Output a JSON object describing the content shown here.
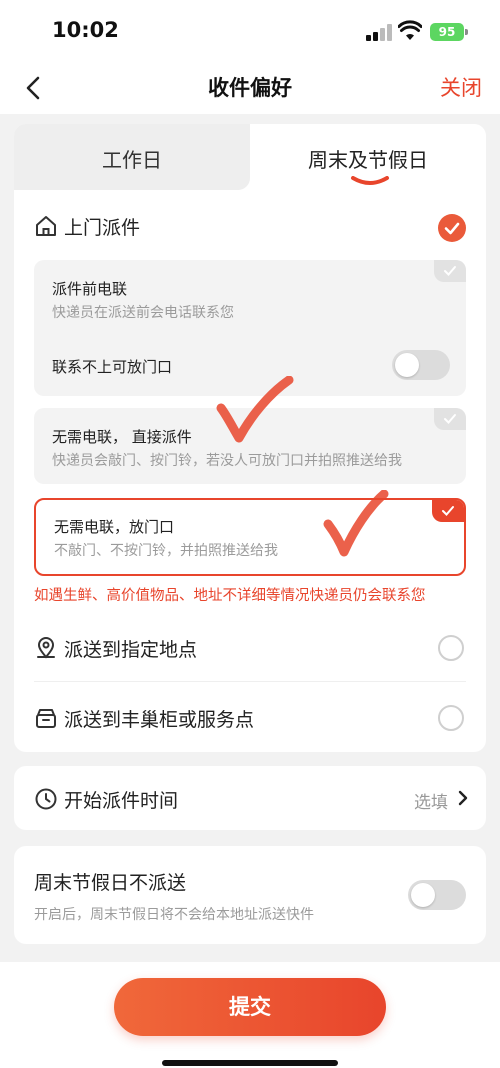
{
  "status_bar": {
    "time": "10:02",
    "battery": "95"
  },
  "nav": {
    "title": "收件偏好",
    "close_label": "关闭"
  },
  "tabs": [
    {
      "label": "工作日",
      "selected": false
    },
    {
      "label": "周末及节假日",
      "selected": true
    }
  ],
  "door_delivery": {
    "label": "上门派件",
    "checked": true,
    "options": [
      {
        "title": "派件前电联",
        "desc": "快递员在派送前会电话联系您",
        "selected": false
      },
      {
        "title": "无需电联， 直接派件",
        "desc": "快递员会敲门、按门铃，若没人可放门口并拍照推送给我",
        "selected": false
      },
      {
        "title": "无需电联，放门口",
        "desc": "不敲门、不按门铃，并拍照推送给我",
        "selected": true
      }
    ],
    "toggle_label": "联系不上可放门口",
    "toggle_on": false,
    "warning": "如遇生鲜、高价值物品、地址不详细等情况快递员仍会联系您"
  },
  "other_options": [
    {
      "label": "派送到指定地点",
      "icon": "location-pin-icon",
      "checked": false
    },
    {
      "label": "派送到丰巢柜或服务点",
      "icon": "locker-icon",
      "checked": false
    }
  ],
  "start_time": {
    "label": "开始派件时间",
    "value": "选填"
  },
  "weekend": {
    "title": "周末节假日不派送",
    "desc": "开启后，周末节假日将不会给本地址派送快件",
    "toggle_on": false
  },
  "submit_label": "提交",
  "colors": {
    "accent": "#e8452c",
    "check": "#ea5a3a"
  }
}
